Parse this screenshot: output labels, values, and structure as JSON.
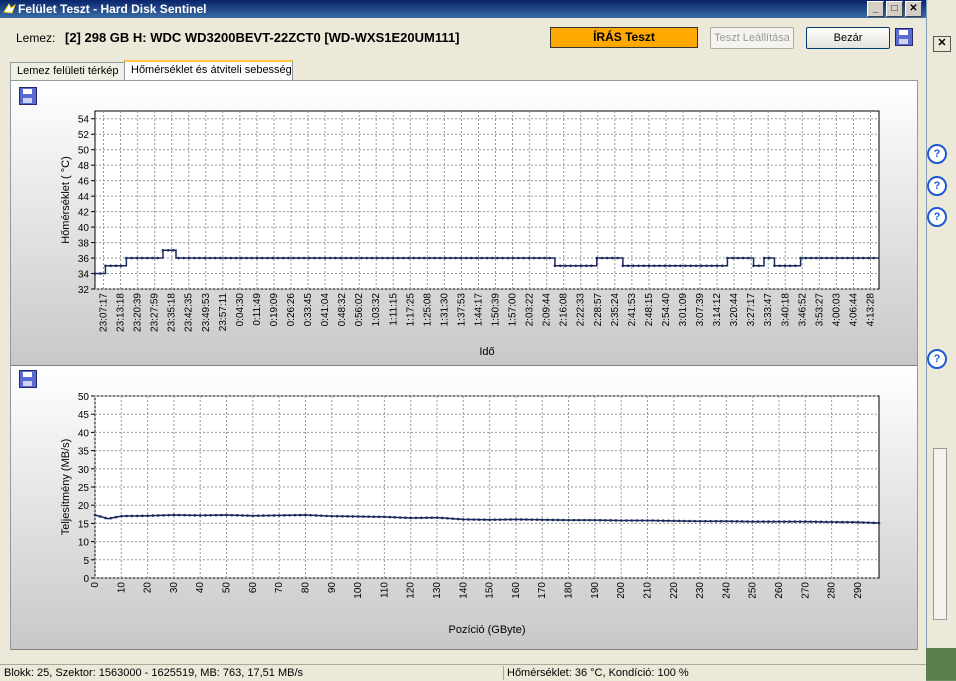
{
  "window": {
    "title": "Felület Teszt - Hard Disk Sentinel"
  },
  "header": {
    "disk_label": "Lemez:",
    "disk_value": "[2] 298 GB H: WDC WD3200BEVT-22ZCT0 [WD-WXS1E20UM111]",
    "status": "ÍRÁS Teszt",
    "status_color": "#ffa800",
    "stop_button": "Teszt Leállítása",
    "close_button": "Bezár"
  },
  "tabs": [
    {
      "label": "Lemez felületi térkép",
      "active": false
    },
    {
      "label": "Hőmérséklet és átviteli sebesség",
      "active": true
    }
  ],
  "status_bar": {
    "left": "Blokk: 25, Szektor: 1563000 - 1625519, MB: 763, 17,51 MB/s",
    "right": "Hőmérséklet: 36  °C,  Kondíció: 100 %"
  },
  "chart_data": [
    {
      "type": "line",
      "xlabel": "Idő",
      "ylabel": "Hőmérséklet ( °C)",
      "ylim": [
        32,
        55
      ],
      "yticks": [
        32,
        34,
        36,
        38,
        40,
        42,
        44,
        46,
        48,
        50,
        52,
        54
      ],
      "grid": true,
      "xticks": [
        "23:07:17",
        "23:13:18",
        "23:20:39",
        "23:27:59",
        "23:35:18",
        "23:42:35",
        "23:49:53",
        "23:57:11",
        "0:04:30",
        "0:11:49",
        "0:19:09",
        "0:26:26",
        "0:33:45",
        "0:41:04",
        "0:48:32",
        "0:56:02",
        "1:03:32",
        "1:11:15",
        "1:17:25",
        "1:25:08",
        "1:31:30",
        "1:37:53",
        "1:44:17",
        "1:50:39",
        "1:57:00",
        "2:03:22",
        "2:09:44",
        "2:16:08",
        "2:22:33",
        "2:28:57",
        "2:35:24",
        "2:41:53",
        "2:48:15",
        "2:54:40",
        "3:01:09",
        "3:07:39",
        "3:14:12",
        "3:20:44",
        "3:27:17",
        "3:33:47",
        "3:40:18",
        "3:46:52",
        "3:53:27",
        "4:00:03",
        "4:06:44",
        "4:13:28"
      ],
      "segments": [
        {
          "from": 0,
          "to": 2,
          "value": 34
        },
        {
          "from": 2,
          "to": 6,
          "value": 35
        },
        {
          "from": 6,
          "to": 13,
          "value": 36
        },
        {
          "from": 13,
          "to": 15.5,
          "value": 37
        },
        {
          "from": 15.5,
          "to": 88,
          "value": 36
        },
        {
          "from": 88,
          "to": 96,
          "value": 35
        },
        {
          "from": 96,
          "to": 101,
          "value": 36
        },
        {
          "from": 101,
          "to": 121,
          "value": 35
        },
        {
          "from": 121,
          "to": 126,
          "value": 36
        },
        {
          "from": 126,
          "to": 128,
          "value": 35
        },
        {
          "from": 128,
          "to": 130,
          "value": 36
        },
        {
          "from": 130,
          "to": 135,
          "value": 35
        },
        {
          "from": 135,
          "to": 150,
          "value": 36
        }
      ],
      "x_count": 150
    },
    {
      "type": "line",
      "xlabel": "Pozíció (GByte)",
      "ylabel": "Teljesítmény (MB/s)",
      "ylim": [
        0,
        50
      ],
      "yticks": [
        0,
        5,
        10,
        15,
        20,
        25,
        30,
        35,
        40,
        45,
        50
      ],
      "xlim": [
        0,
        298
      ],
      "xticks": [
        0,
        10,
        20,
        30,
        40,
        50,
        60,
        70,
        80,
        90,
        100,
        110,
        120,
        130,
        140,
        150,
        160,
        170,
        180,
        190,
        200,
        210,
        220,
        230,
        240,
        250,
        260,
        270,
        280,
        290
      ],
      "grid": true,
      "x": [
        0,
        5,
        10,
        20,
        30,
        40,
        50,
        60,
        70,
        80,
        90,
        100,
        110,
        120,
        130,
        140,
        150,
        160,
        170,
        180,
        190,
        200,
        210,
        220,
        230,
        240,
        250,
        260,
        270,
        280,
        290,
        298
      ],
      "values": [
        17.3,
        16.3,
        17.0,
        17.1,
        17.3,
        17.2,
        17.3,
        17.1,
        17.2,
        17.3,
        17.0,
        16.9,
        16.8,
        16.5,
        16.6,
        16.1,
        16.0,
        16.1,
        16.0,
        15.9,
        15.9,
        15.8,
        15.8,
        15.7,
        15.6,
        15.6,
        15.5,
        15.5,
        15.5,
        15.4,
        15.3,
        15.1
      ]
    }
  ]
}
